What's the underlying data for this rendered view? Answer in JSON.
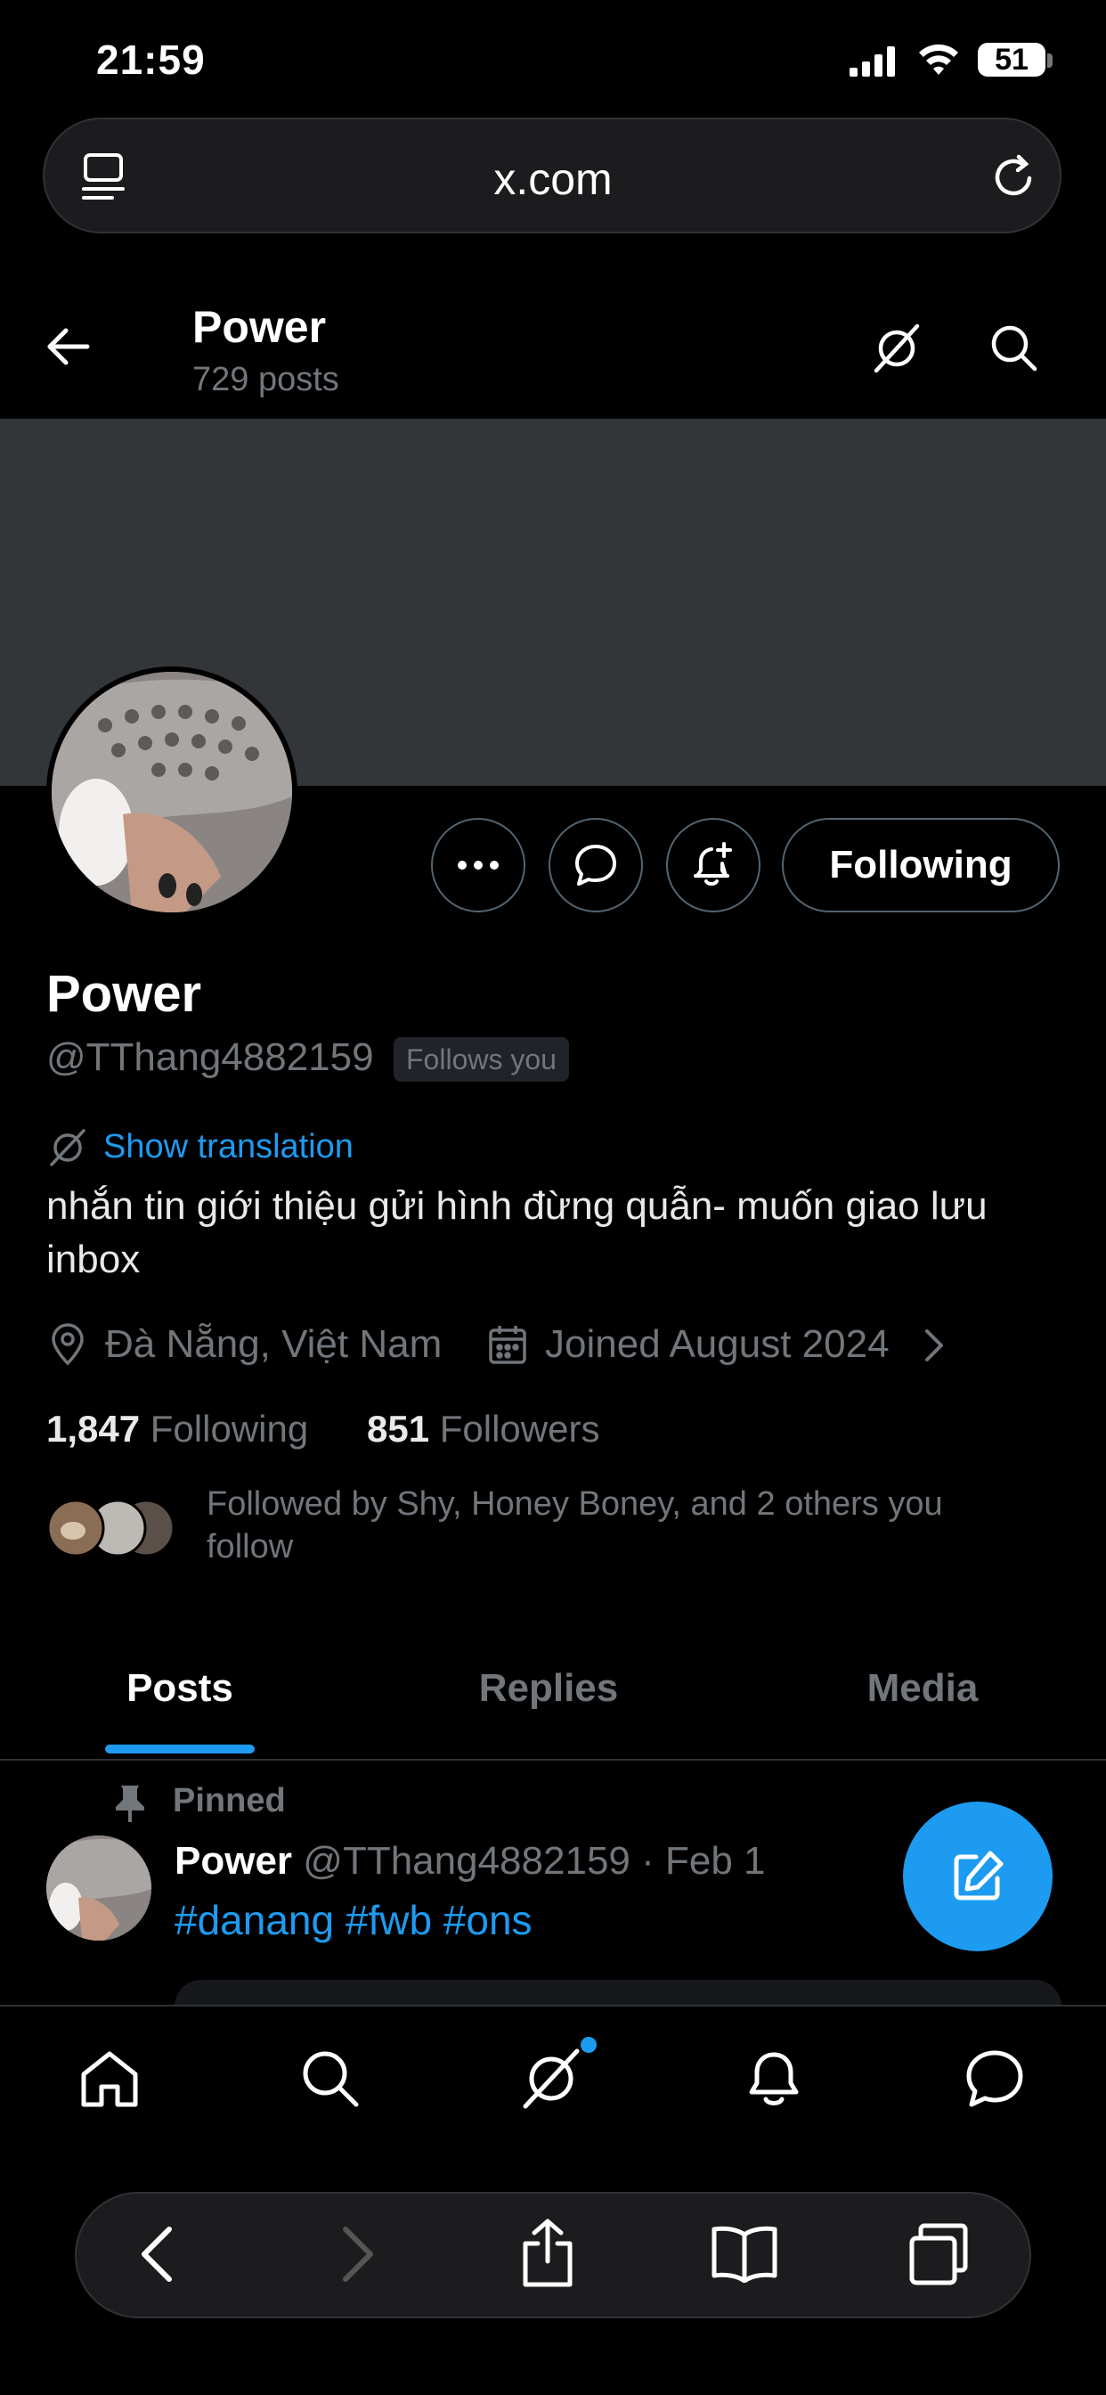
{
  "status_bar": {
    "time": "21:59",
    "battery": "51"
  },
  "browser": {
    "url": "x.com"
  },
  "profile_header": {
    "name": "Power",
    "post_count": "729 posts"
  },
  "profile": {
    "name": "Power",
    "handle": "@TThang4882159",
    "follows_you_badge": "Follows you",
    "following_button": "Following",
    "show_translation": "Show translation",
    "bio": "nhắn tin giới thiệu gửi hình đừng quẫn- muốn giao lưu inbox",
    "location": "Đà Nẵng, Việt Nam",
    "joined": "Joined August 2024",
    "following_count": "1,847",
    "following_label": "Following",
    "followers_count": "851",
    "followers_label": "Followers",
    "followed_by": "Followed by Shy, Honey Boney, and 2 others you follow"
  },
  "tabs": [
    {
      "label": "Posts",
      "active": true
    },
    {
      "label": "Replies",
      "active": false
    },
    {
      "label": "Media",
      "active": false
    }
  ],
  "pinned_post": {
    "pinned_label": "Pinned",
    "author": "Power",
    "handle_date": "@TThang4882159 · Feb 1",
    "hashtags": "#danang #fwb #ons"
  },
  "colors": {
    "accent": "#1d9bf0",
    "banner": "#333639",
    "muted": "#71767b"
  },
  "icons": {
    "status": [
      "signal-icon",
      "wifi-icon",
      "battery-icon"
    ],
    "browser": [
      "reader-icon",
      "reload-icon"
    ],
    "header": [
      "back-arrow-icon",
      "grok-icon",
      "search-icon"
    ],
    "actions": [
      "more-icon",
      "message-icon",
      "notification-add-icon"
    ],
    "meta": [
      "location-icon",
      "calendar-icon",
      "chevron-right-icon"
    ],
    "nav": [
      "home-icon",
      "search-icon",
      "grok-icon",
      "bell-icon",
      "message-icon"
    ],
    "safari": [
      "back-icon",
      "forward-icon",
      "share-icon",
      "bookmarks-icon",
      "tabs-icon"
    ]
  }
}
